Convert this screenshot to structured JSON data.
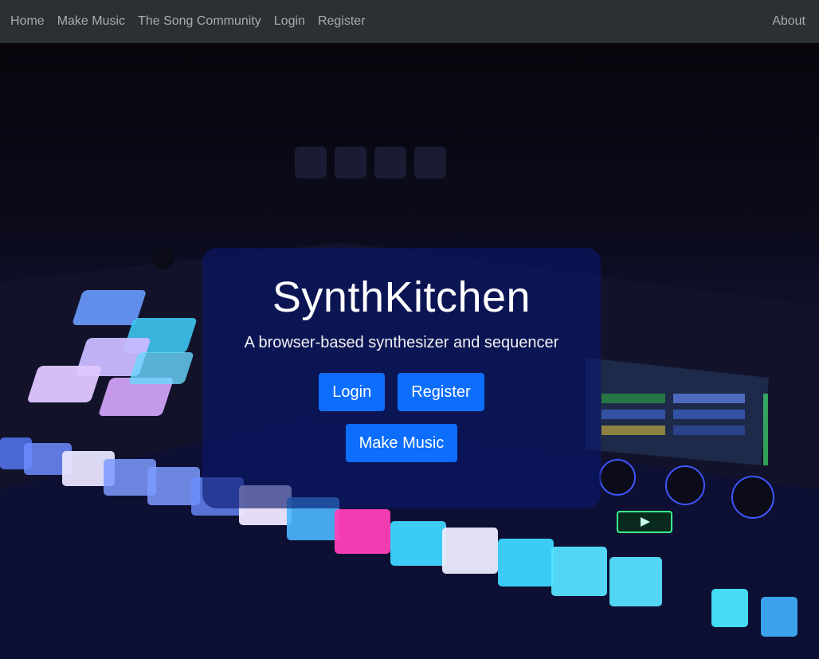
{
  "nav": {
    "links": [
      "Home",
      "Make Music",
      "The Song Community",
      "Login",
      "Register"
    ],
    "about": "About"
  },
  "hero": {
    "title": "SynthKitchen",
    "subtitle": "A browser-based synthesizer and sequencer",
    "login_label": "Login",
    "register_label": "Register",
    "make_music_label": "Make Music"
  },
  "colors": {
    "navbar_bg": "#2b3035",
    "nav_link": "#a7acb1",
    "button_primary": "#0d6efd",
    "card_bg": "rgba(10, 22, 110, 0.62)"
  }
}
